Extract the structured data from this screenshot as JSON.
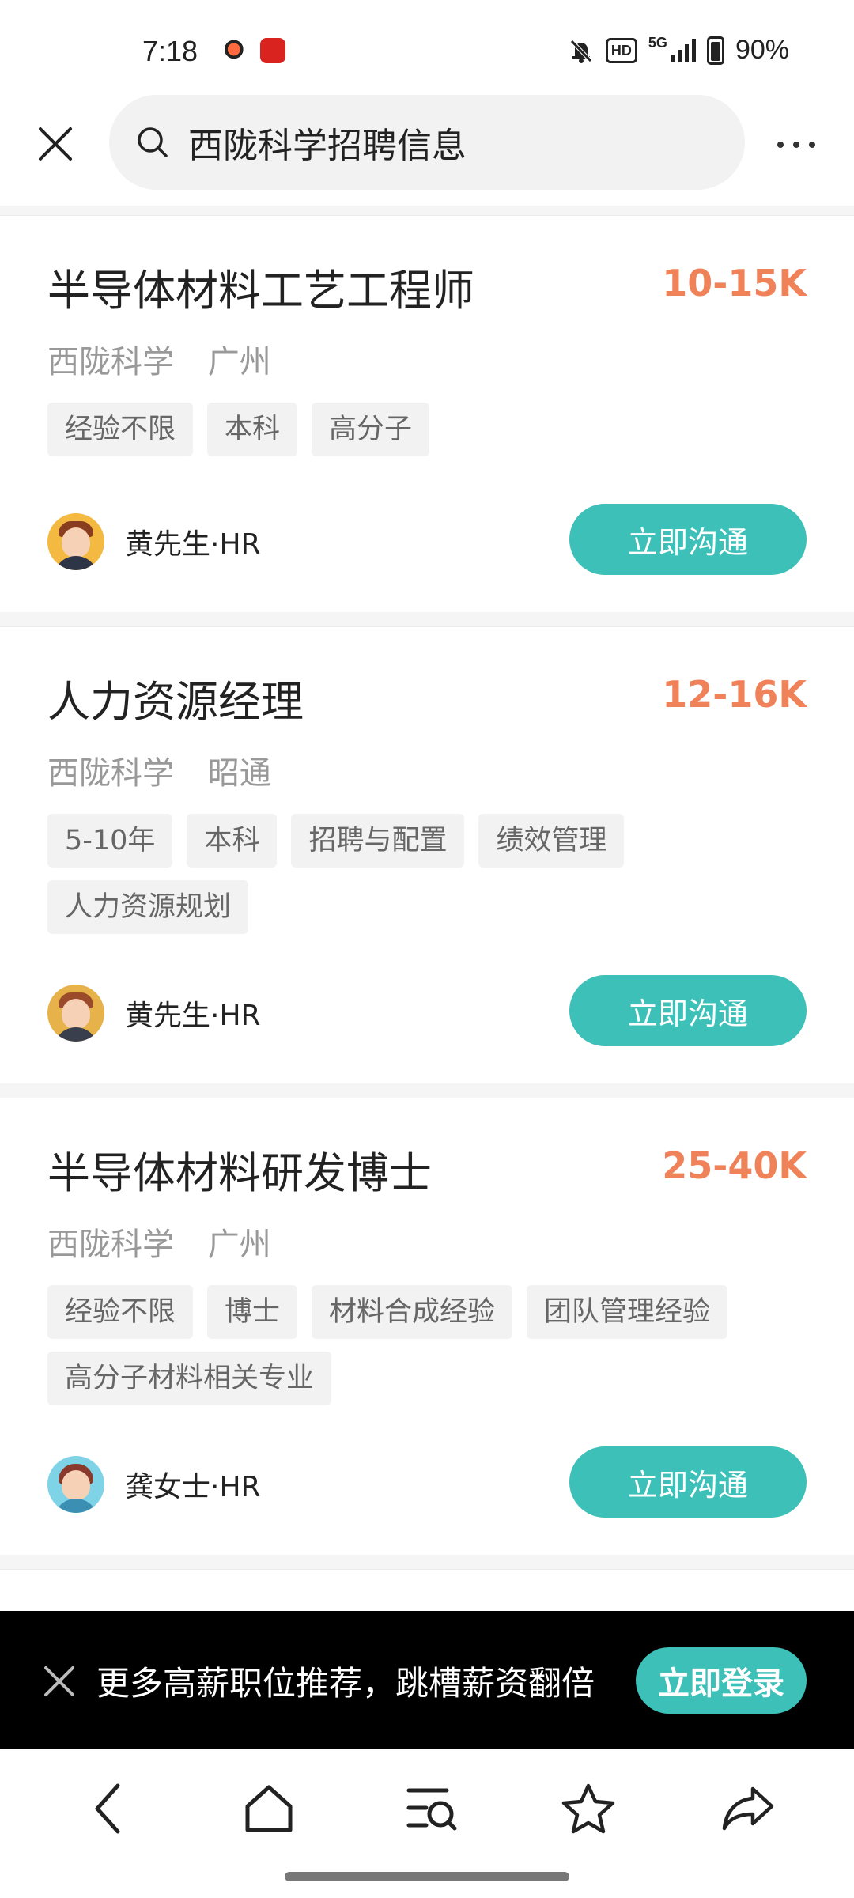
{
  "status_bar": {
    "time": "7:18",
    "network": "5G",
    "hd_badge": "HD",
    "battery": "90%"
  },
  "search": {
    "query": "西陇科学招聘信息",
    "icon": "search-icon"
  },
  "jobs": [
    {
      "title": "半导体材料工艺工程师",
      "salary": "10-15K",
      "company": "西陇科学",
      "city": "广州",
      "tags": [
        "经验不限",
        "本科",
        "高分子"
      ],
      "recruiter": "黄先生·HR",
      "action": "立即沟通"
    },
    {
      "title": "人力资源经理",
      "salary": "12-16K",
      "company": "西陇科学",
      "city": "昭通",
      "tags": [
        "5-10年",
        "本科",
        "招聘与配置",
        "绩效管理",
        "人力资源规划"
      ],
      "recruiter": "黄先生·HR",
      "action": "立即沟通"
    },
    {
      "title": "半导体材料研发博士",
      "salary": "25-40K",
      "company": "西陇科学",
      "city": "广州",
      "tags": [
        "经验不限",
        "博士",
        "材料合成经验",
        "团队管理经验",
        "高分子材料相关专业"
      ],
      "recruiter": "龚女士·HR",
      "action": "立即沟通"
    }
  ],
  "promo": {
    "text": "更多高薪职位推荐，跳槽薪资翻倍",
    "button": "立即登录"
  },
  "colors": {
    "accent": "#3cc0b8",
    "salary": "#f0825a"
  }
}
